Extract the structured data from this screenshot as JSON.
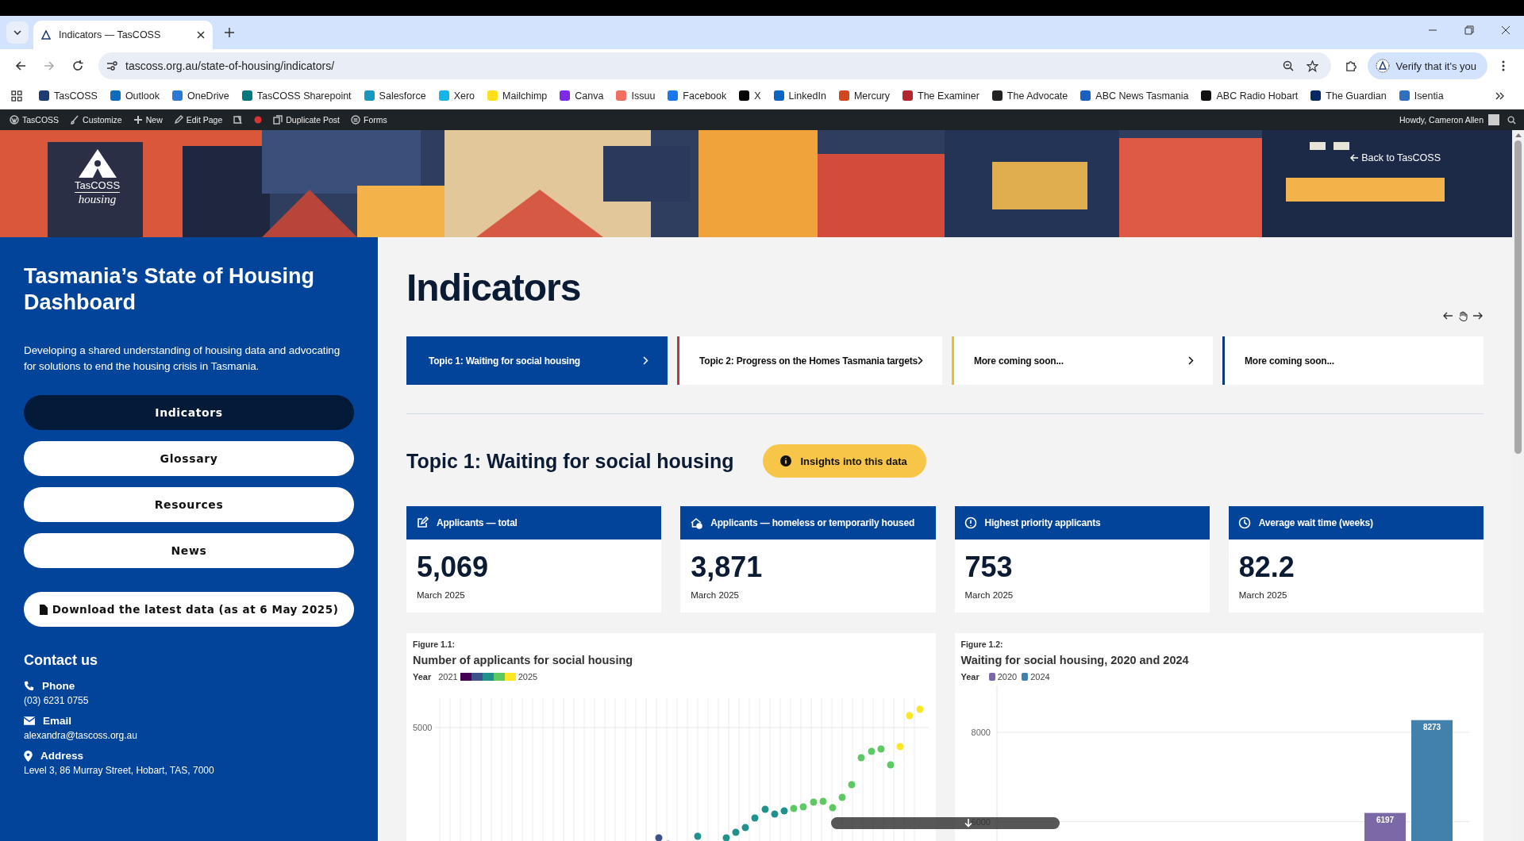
{
  "browser": {
    "tab_title": "Indicators — TasCOSS",
    "url": "tascoss.org.au/state-of-housing/indicators/",
    "profile_button": "Verify that it's you",
    "bookmarks": [
      {
        "label": "TasCOSS"
      },
      {
        "label": "Outlook"
      },
      {
        "label": "OneDrive"
      },
      {
        "label": "TasCOSS Sharepoint"
      },
      {
        "label": "Salesforce"
      },
      {
        "label": "Xero"
      },
      {
        "label": "Mailchimp"
      },
      {
        "label": "Canva"
      },
      {
        "label": "Issuu"
      },
      {
        "label": "Facebook"
      },
      {
        "label": "X"
      },
      {
        "label": "LinkedIn"
      },
      {
        "label": "Mercury"
      },
      {
        "label": "The Examiner"
      },
      {
        "label": "The Advocate"
      },
      {
        "label": "ABC News Tasmania"
      },
      {
        "label": "ABC Radio Hobart"
      },
      {
        "label": "The Guardian"
      },
      {
        "label": "Isentia"
      }
    ]
  },
  "admin_bar": {
    "items": [
      {
        "kind": "site",
        "label": "TasCOSS"
      },
      {
        "kind": "customize",
        "label": "Customize"
      },
      {
        "kind": "new",
        "label": "New"
      },
      {
        "kind": "edit",
        "label": "Edit Page"
      },
      {
        "kind": "seo"
      },
      {
        "kind": "status"
      },
      {
        "kind": "duplicate",
        "label": "Duplicate Post"
      },
      {
        "kind": "forms",
        "label": "Forms"
      }
    ],
    "greeting": "Howdy, Cameron Allen"
  },
  "banner": {
    "logo_name": "TasCOSS",
    "logo_tagline": "housing",
    "back_link": "Back to TasCOSS"
  },
  "sidebar": {
    "title": "Tasmania’s State of Housing Dashboard",
    "description": "Developing a shared understanding of housing data and advocating for solutions to end the housing crisis in Tasmania.",
    "nav": [
      {
        "label": "Indicators",
        "selected": true
      },
      {
        "label": "Glossary",
        "selected": false
      },
      {
        "label": "Resources",
        "selected": false
      },
      {
        "label": "News",
        "selected": false
      }
    ],
    "download_button": "Download the latest data (as at 6 May 2025)",
    "contact": {
      "heading": "Contact us",
      "items": [
        {
          "kind": "phone",
          "label": "Phone",
          "value": "(03) 6231 0755"
        },
        {
          "kind": "email",
          "label": "Email",
          "value": "alexandra@tascoss.org.au"
        },
        {
          "kind": "address",
          "label": "Address",
          "value": "Level 3, 86 Murray Street, Hobart, TAS, 7000"
        }
      ]
    }
  },
  "main": {
    "title": "Indicators",
    "topics": [
      {
        "label": "Topic 1: Waiting for social housing",
        "selected": true,
        "color": "#02449a",
        "chevron": true
      },
      {
        "label": "Topic 2: Progress on the Homes Tasmania targets",
        "selected": false,
        "color": "#c8303a",
        "chevron": true
      },
      {
        "label": "More coming soon...",
        "selected": false,
        "color": "#f2b830",
        "chevron": true
      },
      {
        "label": "More coming soon...",
        "selected": false,
        "color": "#0a3a7a",
        "chevron": false
      }
    ],
    "section_title": "Topic 1: Waiting for social housing",
    "insights_button": "Insights into this data",
    "stats": [
      {
        "kind": "edit",
        "label": "Applicants — total",
        "value": "5,069",
        "date": "March 2025"
      },
      {
        "kind": "home",
        "label": "Applicants — homeless or temporarily housed",
        "value": "3,871",
        "date": "March 2025"
      },
      {
        "kind": "alert",
        "label": "Highest priority applicants",
        "value": "753",
        "date": "March 2025"
      },
      {
        "kind": "clock",
        "label": "Average wait time (weeks)",
        "value": "82.2",
        "date": "March 2025"
      }
    ],
    "figure_1": {
      "number": "Figure 1.1:",
      "title": "Number of applicants for social housing",
      "legend_title": "Year",
      "legend_start": "2021",
      "legend_end": "2025",
      "y_tick": "5000"
    },
    "figure_2": {
      "number": "Figure 1.2:",
      "title": "Waiting for social housing, 2020 and 2024",
      "legend_title": "Year",
      "chart_data": {
        "type": "bar",
        "ylim": [
          5480,
          9030
        ],
        "yticks": [
          6000,
          8000
        ],
        "data_labels": true,
        "series": [
          {
            "name": "2020",
            "color": "#7b68a6",
            "values": [
              6197
            ]
          },
          {
            "name": "2024",
            "color": "#4381ad",
            "values": [
              8273
            ]
          }
        ]
      }
    }
  }
}
